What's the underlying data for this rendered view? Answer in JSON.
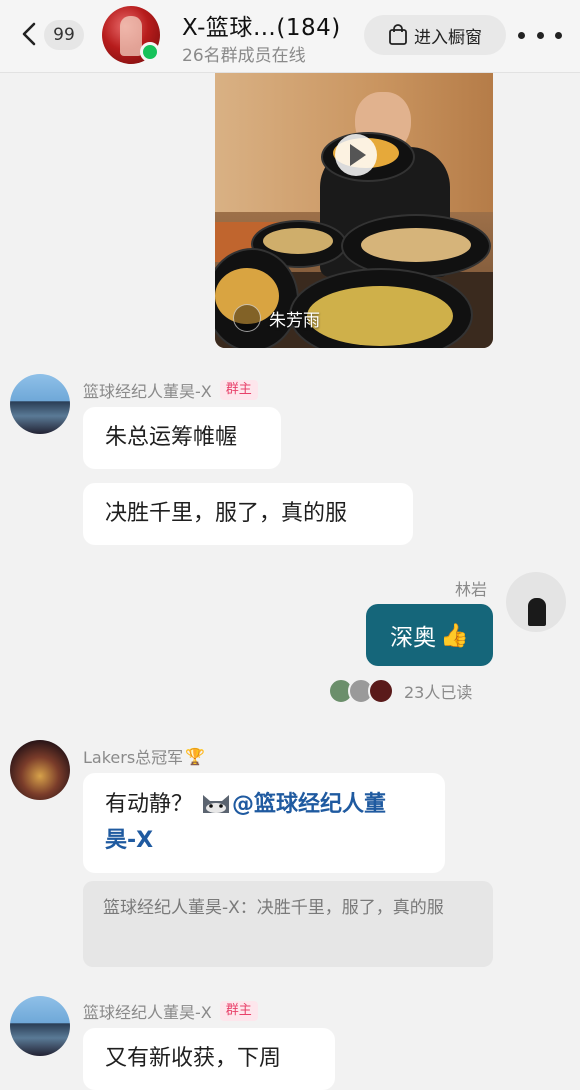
{
  "header": {
    "back_count": "99",
    "group_name": "X-篮球…(184)",
    "online_status": "26名群成员在线",
    "enter_button": "进入橱窗",
    "more_icon": "more-icon"
  },
  "video_message": {
    "watermark_name": "朱芳雨",
    "play_icon": "play-icon"
  },
  "messages": [
    {
      "sender": "篮球经纪人董昊-X",
      "badge": "群主",
      "bubbles": [
        "朱总运筹帷幄",
        "决胜千里，服了，真的服"
      ]
    },
    {
      "sender": "林岩",
      "bubble": "深奥",
      "emoji": "👍",
      "read_count": "23人已读"
    },
    {
      "sender": "Lakers总冠军",
      "sender_emoji": "🏆",
      "text_prefix": "有动静？",
      "mention_line1": "@篮球经纪人董",
      "mention_line2": "昊-X",
      "quote": "篮球经纪人董昊-X：决胜千里，服了，真的服"
    },
    {
      "sender": "篮球经纪人董昊-X",
      "badge": "群主",
      "bubble": "又有新收获，下周"
    }
  ],
  "colors": {
    "own_bubble": "#15667a",
    "owner_badge": "#e8416a",
    "mention": "#1f5aa0",
    "online": "#16c25a"
  }
}
